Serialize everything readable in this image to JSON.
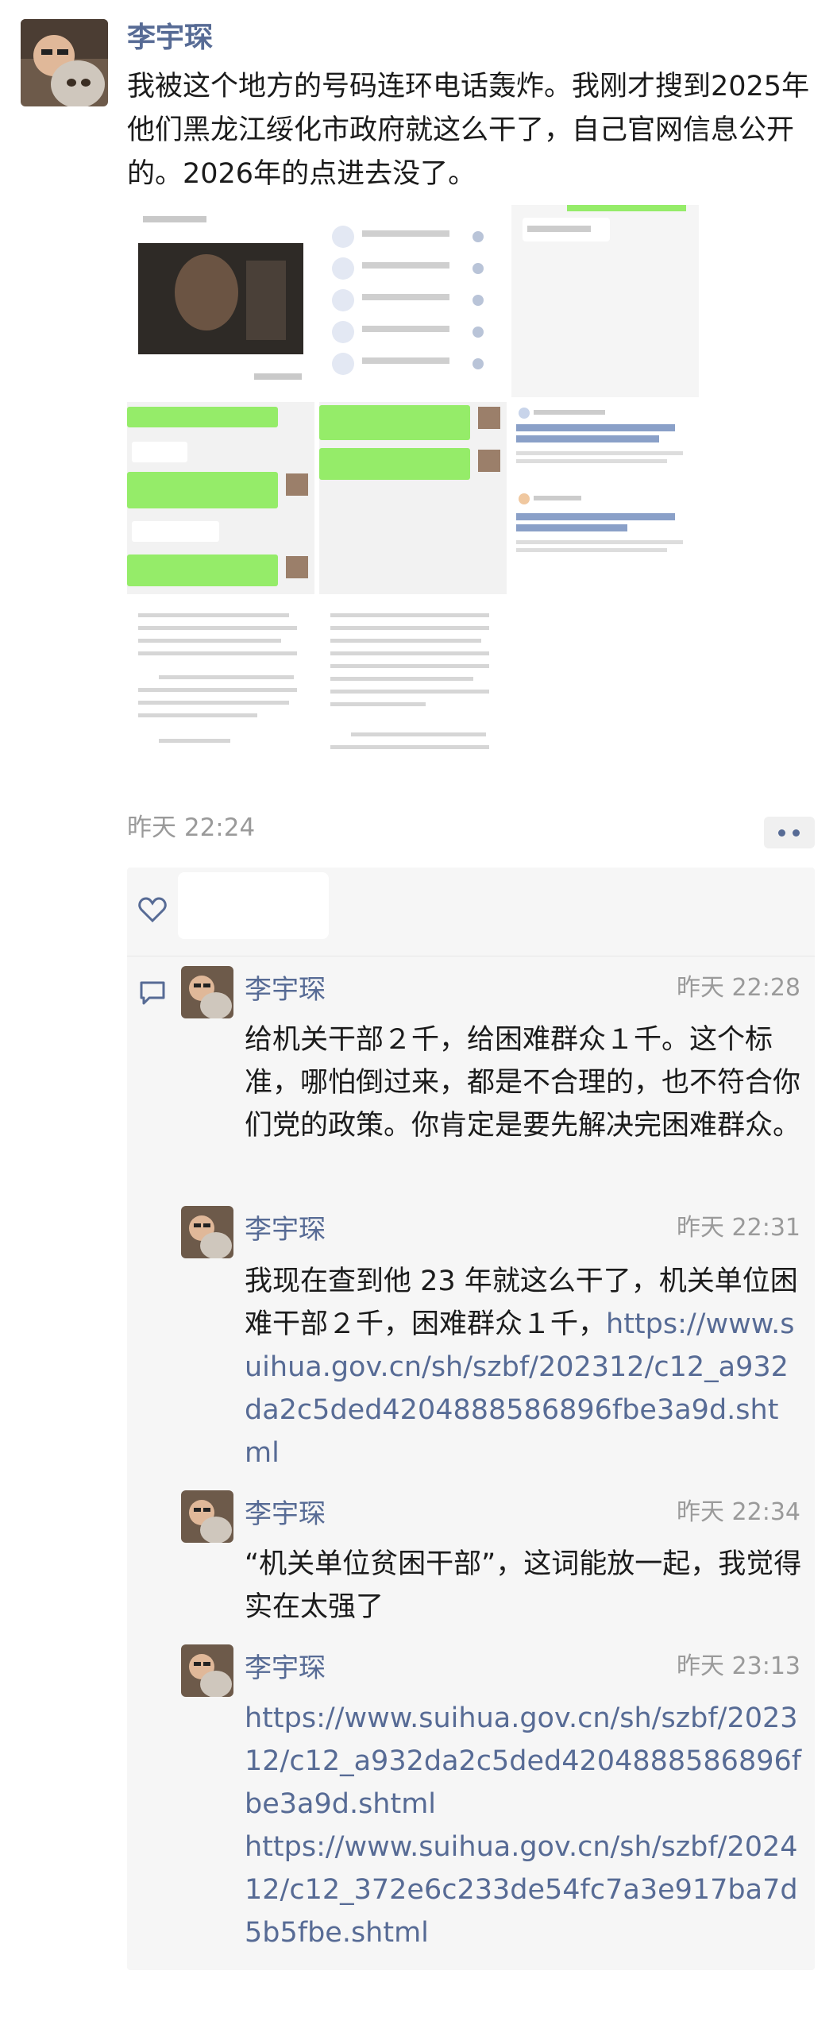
{
  "post": {
    "author": "李宇琛",
    "text": "我被这个地方的号码连环电话轰炸。我刚才搜到2025年他们黑龙江绥化市政府就这么干了，自己官网信息公开的。2026年的点进去没了。",
    "time": "昨天 22:24"
  },
  "comments": [
    {
      "author": "李宇琛",
      "time": "昨天 22:28",
      "text": "给机关干部２千，给困难群众１千。这个标准，哪怕倒过来，都是不合理的，也不符合你们党的政策。你肯定是要先解决完困难群众。"
    },
    {
      "author": "李宇琛",
      "time": "昨天 22:31",
      "text": "我现在查到他 23 年就这么干了，机关单位困难干部２千，困难群众１千，",
      "link": "https://www.suihua.gov.cn/sh/szbf/202312/c12_a932da2c5ded4204888586896fbe3a9d.shtml"
    },
    {
      "author": "李宇琛",
      "time": "昨天 22:34",
      "text": "“机关单位贫困干部”，这词能放一起，我觉得实在太强了"
    },
    {
      "author": "李宇琛",
      "time": "昨天 23:13",
      "link1": "https://www.suihua.gov.cn/sh/szbf/202312/c12_a932da2c5ded4204888586896fbe3a9d.shtml",
      "link2": "https://www.suihua.gov.cn/sh/szbf/202412/c12_372e6c233de54fc7a3e917ba7d5b5fbe.shtml"
    }
  ],
  "icons": {
    "more": "more-dots-icon",
    "like": "heart-icon",
    "comment": "comment-bubble-icon"
  },
  "colors": {
    "name": "#576b95",
    "time": "#9a9a9a",
    "panel": "#f6f6f6",
    "chat_green": "#95ec69"
  }
}
